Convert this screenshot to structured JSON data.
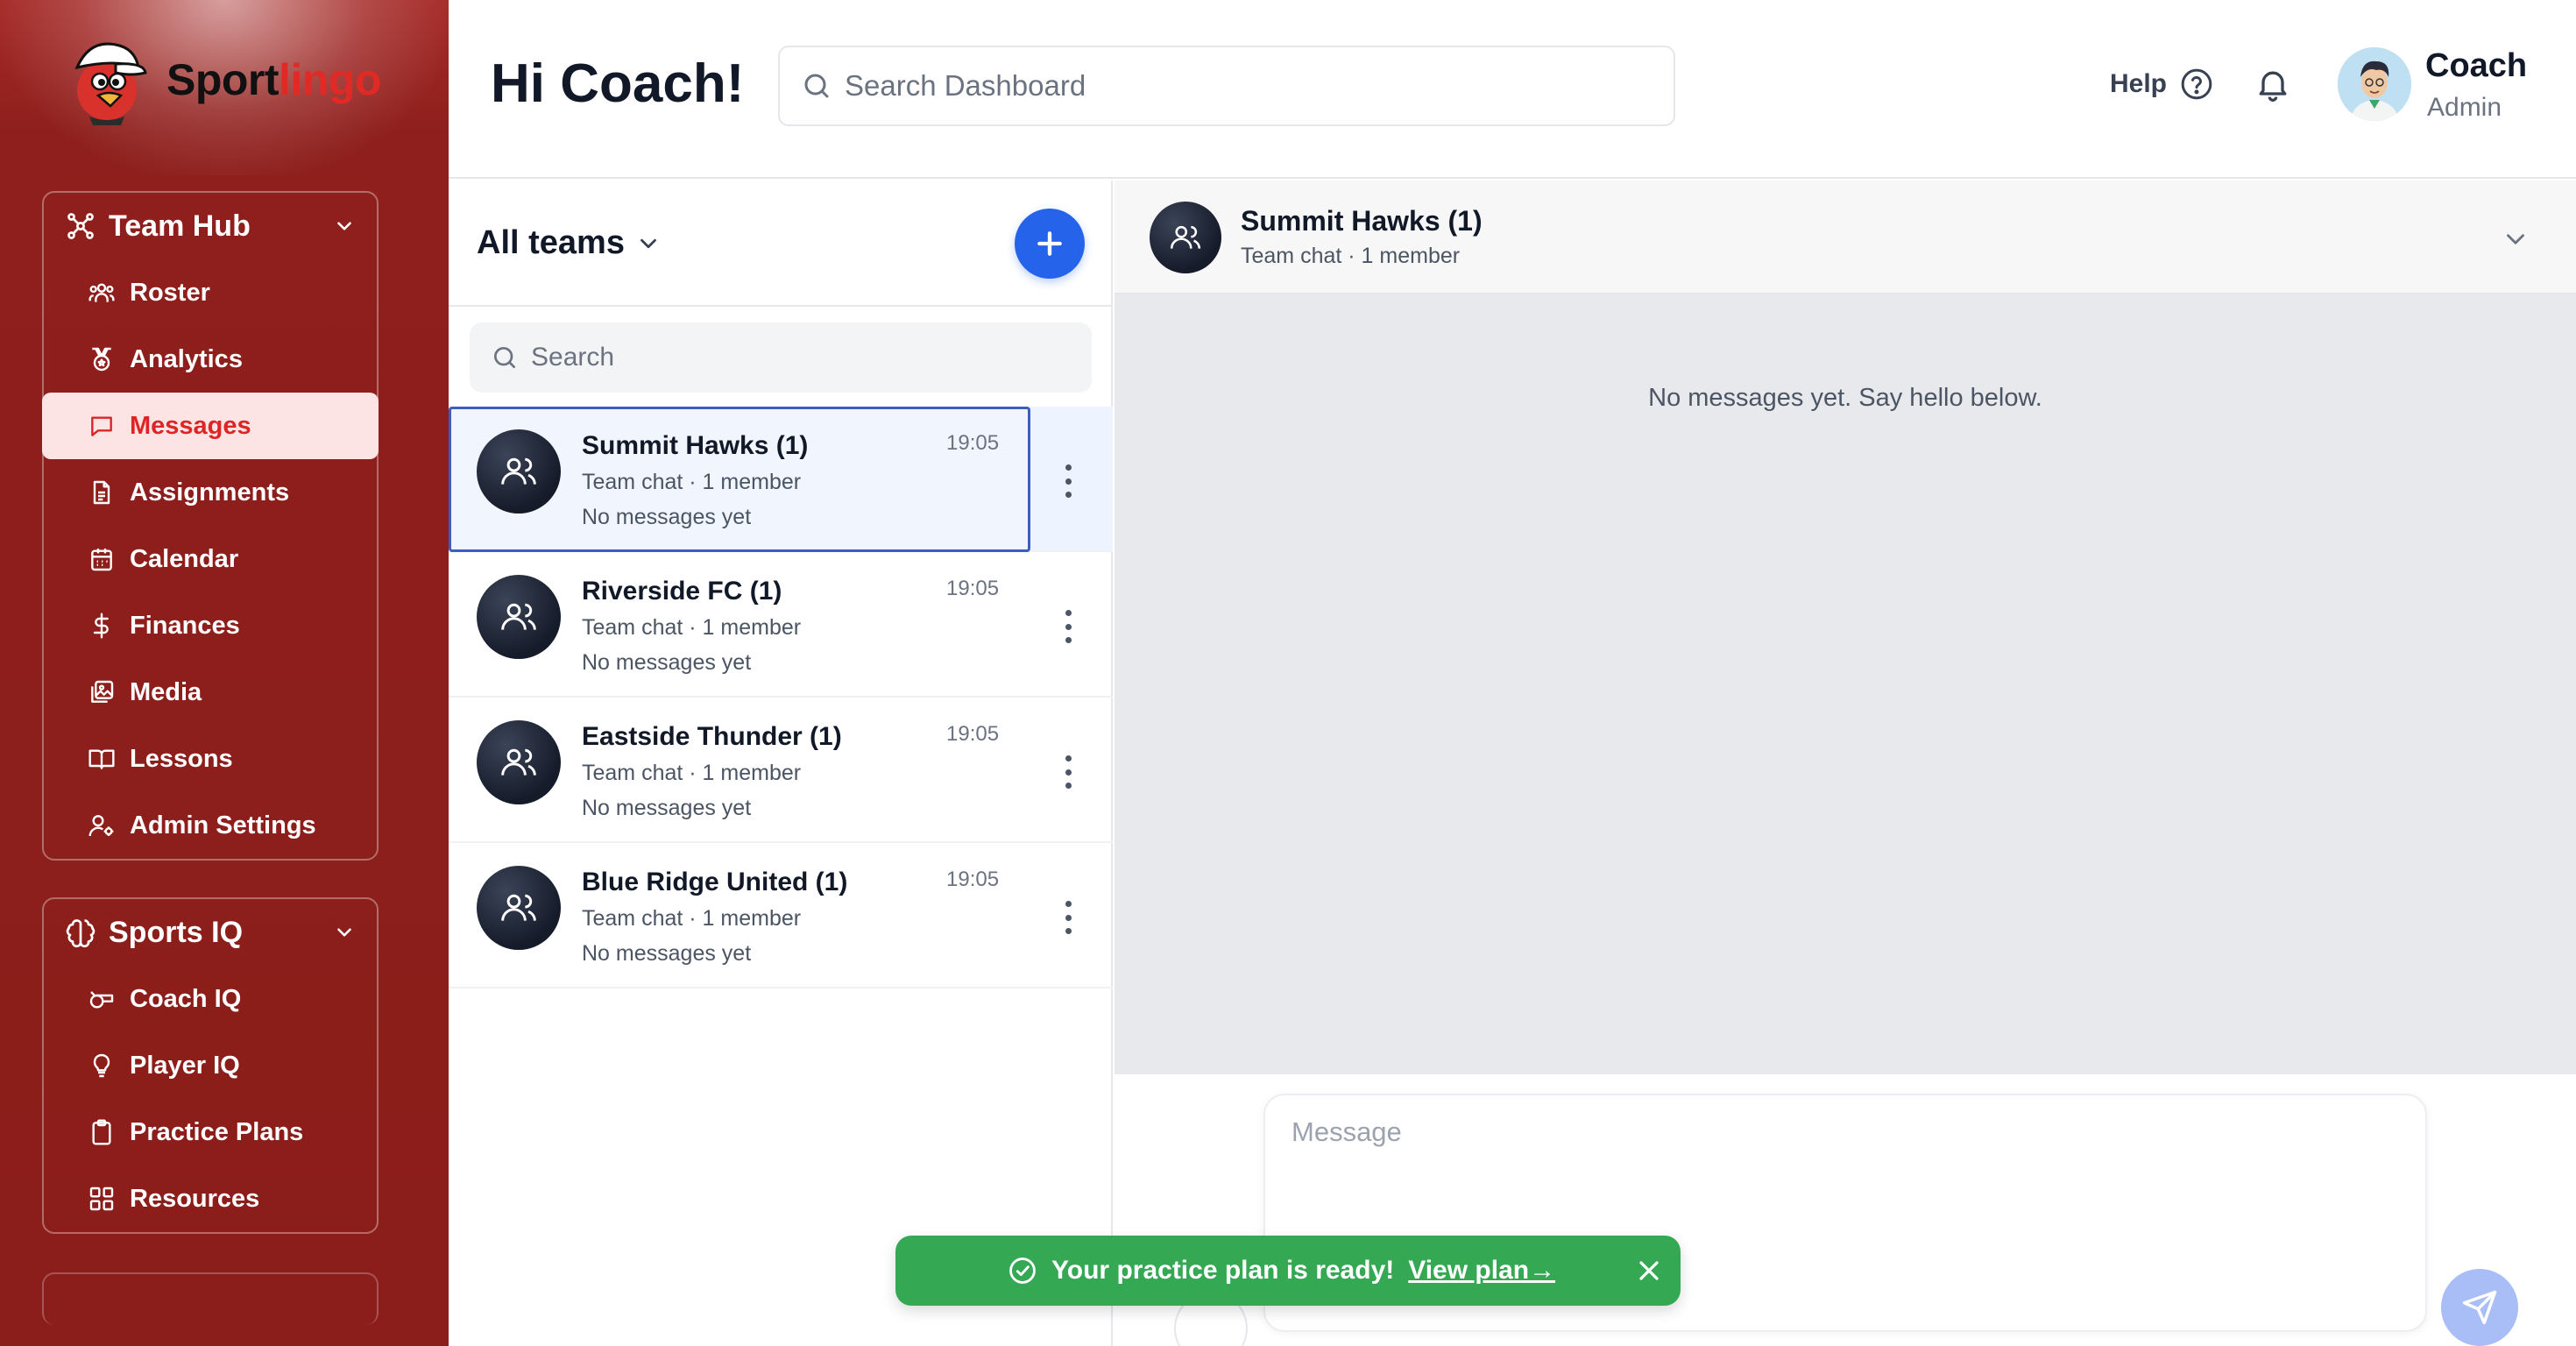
{
  "brand": {
    "name_part1": "Sport",
    "name_part2": "lingo"
  },
  "header": {
    "greeting": "Hi Coach!",
    "search_placeholder": "Search Dashboard",
    "help_label": "Help",
    "user_name": "Coach",
    "user_role": "Admin"
  },
  "sidebar": {
    "groups": [
      {
        "title": "Team Hub",
        "items": [
          {
            "label": "Roster",
            "icon": "users-group-icon"
          },
          {
            "label": "Analytics",
            "icon": "medal-icon"
          },
          {
            "label": "Messages",
            "icon": "message-square-icon",
            "active": true
          },
          {
            "label": "Assignments",
            "icon": "file-text-icon"
          },
          {
            "label": "Calendar",
            "icon": "calendar-icon"
          },
          {
            "label": "Finances",
            "icon": "dollar-icon"
          },
          {
            "label": "Media",
            "icon": "image-icon"
          },
          {
            "label": "Lessons",
            "icon": "book-open-icon"
          },
          {
            "label": "Admin Settings",
            "icon": "user-cog-icon"
          }
        ]
      },
      {
        "title": "Sports IQ",
        "items": [
          {
            "label": "Coach IQ",
            "icon": "whistle-icon"
          },
          {
            "label": "Player IQ",
            "icon": "lightbulb-icon"
          },
          {
            "label": "Practice Plans",
            "icon": "clipboard-icon"
          },
          {
            "label": "Resources",
            "icon": "grid-icon"
          }
        ]
      }
    ]
  },
  "teams": {
    "filter_label": "All teams",
    "search_placeholder": "Search",
    "list": [
      {
        "name": "Summit Hawks (1)",
        "subtitle": "Team chat · 1 member",
        "last_message": "No messages yet",
        "time": "19:05",
        "selected": true
      },
      {
        "name": "Riverside FC (1)",
        "subtitle": "Team chat · 1 member",
        "last_message": "No messages yet",
        "time": "19:05"
      },
      {
        "name": "Eastside Thunder (1)",
        "subtitle": "Team chat · 1 member",
        "last_message": "No messages yet",
        "time": "19:05"
      },
      {
        "name": "Blue Ridge United (1)",
        "subtitle": "Team chat · 1 member",
        "last_message": "No messages yet",
        "time": "19:05"
      }
    ]
  },
  "chat": {
    "title": "Summit Hawks (1)",
    "subtitle": "Team chat · 1 member",
    "empty_text": "No messages yet. Say hello below.",
    "message_placeholder": "Message"
  },
  "toast": {
    "message": "Your practice plan is ready!",
    "link_label": "View plan→"
  },
  "colors": {
    "sidebar_bg": "#8b1d1a",
    "active_item_bg": "#fde4e4",
    "active_item_text": "#dc2626",
    "primary_blue": "#2563eb",
    "toast_green": "#34a853",
    "brand_red": "#e12a26"
  }
}
